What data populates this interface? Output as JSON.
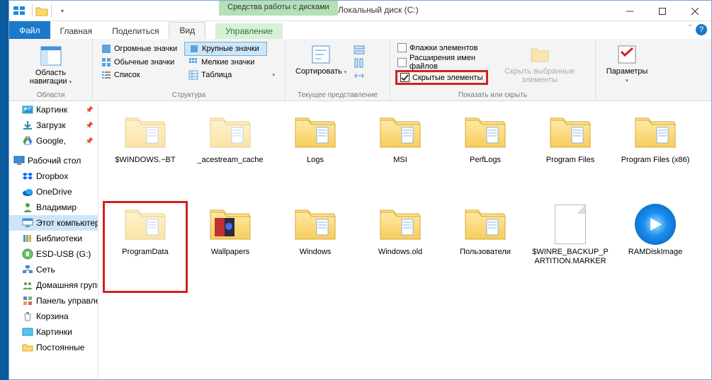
{
  "title": "Локальный диск (C:)",
  "context_tab": "Средства работы с дисками",
  "tabs": {
    "file": "Файл",
    "home": "Главная",
    "share": "Поделиться",
    "view": "Вид",
    "manage": "Управление"
  },
  "ribbon": {
    "nav_pane": "Область навигации",
    "group_areas": "Области",
    "layout": {
      "huge": "Огромные значки",
      "large": "Крупные значки",
      "normal": "Обычные значки",
      "small": "Мелкие значки",
      "list": "Список",
      "table": "Таблица"
    },
    "group_layout": "Структура",
    "sort": "Сортировать",
    "group_view": "Текущее представление",
    "checks": {
      "flags": "Флажки элементов",
      "ext": "Расширения имен файлов",
      "hidden": "Скрытые элементы"
    },
    "hide_sel": "Скрыть выбранные элементы",
    "options": "Параметры",
    "group_show": "Показать или скрыть"
  },
  "sidebar": [
    {
      "label": "Картинк",
      "icon": "pictures",
      "pin": true
    },
    {
      "label": "Загрузк",
      "icon": "downloads",
      "pin": true
    },
    {
      "label": "Google,",
      "icon": "gdrive",
      "pin": true
    },
    {
      "sep": true
    },
    {
      "label": "Рабочий стол",
      "icon": "desktop",
      "top": true
    },
    {
      "label": "Dropbox",
      "icon": "dropbox"
    },
    {
      "label": "OneDrive",
      "icon": "onedrive"
    },
    {
      "label": "Владимир",
      "icon": "user"
    },
    {
      "label": "Этот компьютер",
      "icon": "pc",
      "sel": true
    },
    {
      "label": "Библиотеки",
      "icon": "libs"
    },
    {
      "label": "ESD-USB (G:)",
      "icon": "usb"
    },
    {
      "label": "Сеть",
      "icon": "network"
    },
    {
      "label": "Домашняя группа",
      "icon": "homegroup"
    },
    {
      "label": "Панель управления",
      "icon": "cpanel"
    },
    {
      "label": "Корзина",
      "icon": "recycle"
    },
    {
      "label": "Картинки",
      "icon": "pictures2"
    },
    {
      "label": "Постоянные",
      "icon": "folder"
    }
  ],
  "files": [
    {
      "label": "$WINDOWS.~BT",
      "type": "folder",
      "hidden": true
    },
    {
      "label": "_acestream_cache",
      "type": "folder",
      "hidden": true
    },
    {
      "label": "Logs",
      "type": "folder"
    },
    {
      "label": "MSI",
      "type": "folder"
    },
    {
      "label": "PerfLogs",
      "type": "folder"
    },
    {
      "label": "Program Files",
      "type": "folder"
    },
    {
      "label": "Program Files (x86)",
      "type": "folder"
    },
    {
      "label": "ProgramData",
      "type": "folder",
      "hidden": true,
      "highlight": true
    },
    {
      "label": "Wallpapers",
      "type": "folder-wall"
    },
    {
      "label": "Windows",
      "type": "folder"
    },
    {
      "label": "Windows.old",
      "type": "folder"
    },
    {
      "label": "Пользователи",
      "type": "folder"
    },
    {
      "label": "$WINRE_BACKUP_PARTITION.MARKER",
      "type": "file"
    },
    {
      "label": "RAMDiskImage",
      "type": "disc"
    }
  ]
}
